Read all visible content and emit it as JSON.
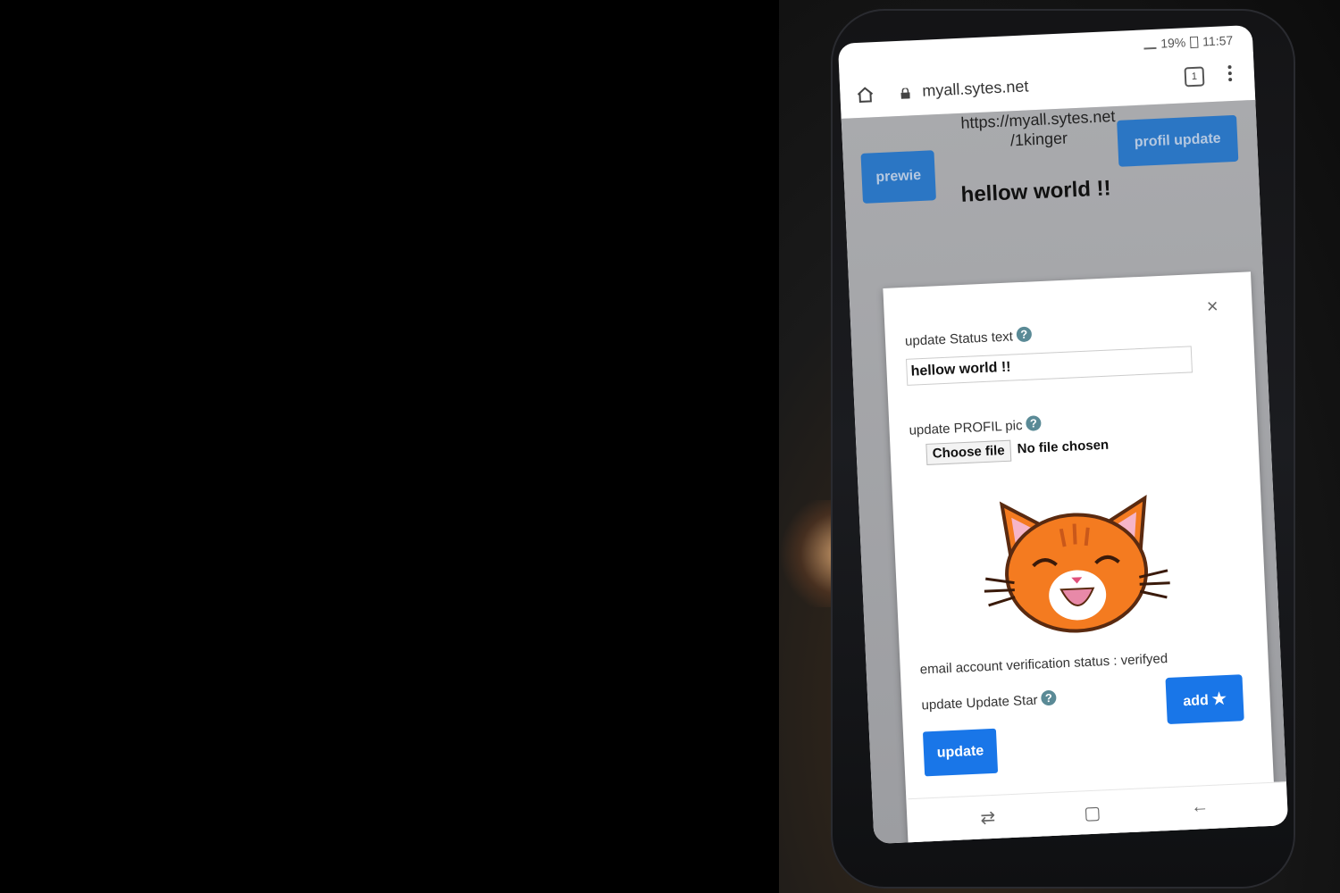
{
  "status_bar": {
    "battery": "19%",
    "time": "11:57"
  },
  "browser": {
    "url": "myall.sytes.net",
    "tab_count": "1"
  },
  "page": {
    "url_path_line1": "https://myall.sytes.net",
    "url_path_line2": "/1kinger",
    "prewie_label": "prewie",
    "profil_update_label": "profil update",
    "status_text": "hellow world !!"
  },
  "modal": {
    "close_label": "×",
    "status_label": "update Status text",
    "status_value": "hellow world !!",
    "pic_label": "update PROFIL pic",
    "choose_file_label": "Choose file",
    "file_status": "No file chosen",
    "verification_text": "email account verification status : verifyed",
    "star_label": "update Update Star",
    "add_label": "add",
    "update_label": "update",
    "help_glyph": "?"
  },
  "icons": {
    "home": "home-icon",
    "lock": "lock-icon",
    "tabs": "tabs-icon",
    "menu": "menu-icon",
    "star": "star-icon",
    "help": "help-icon",
    "close": "close-icon"
  },
  "colors": {
    "primary_button": "#1976e8",
    "help_icon": "#5a8a96",
    "cat_orange": "#f47b20"
  }
}
